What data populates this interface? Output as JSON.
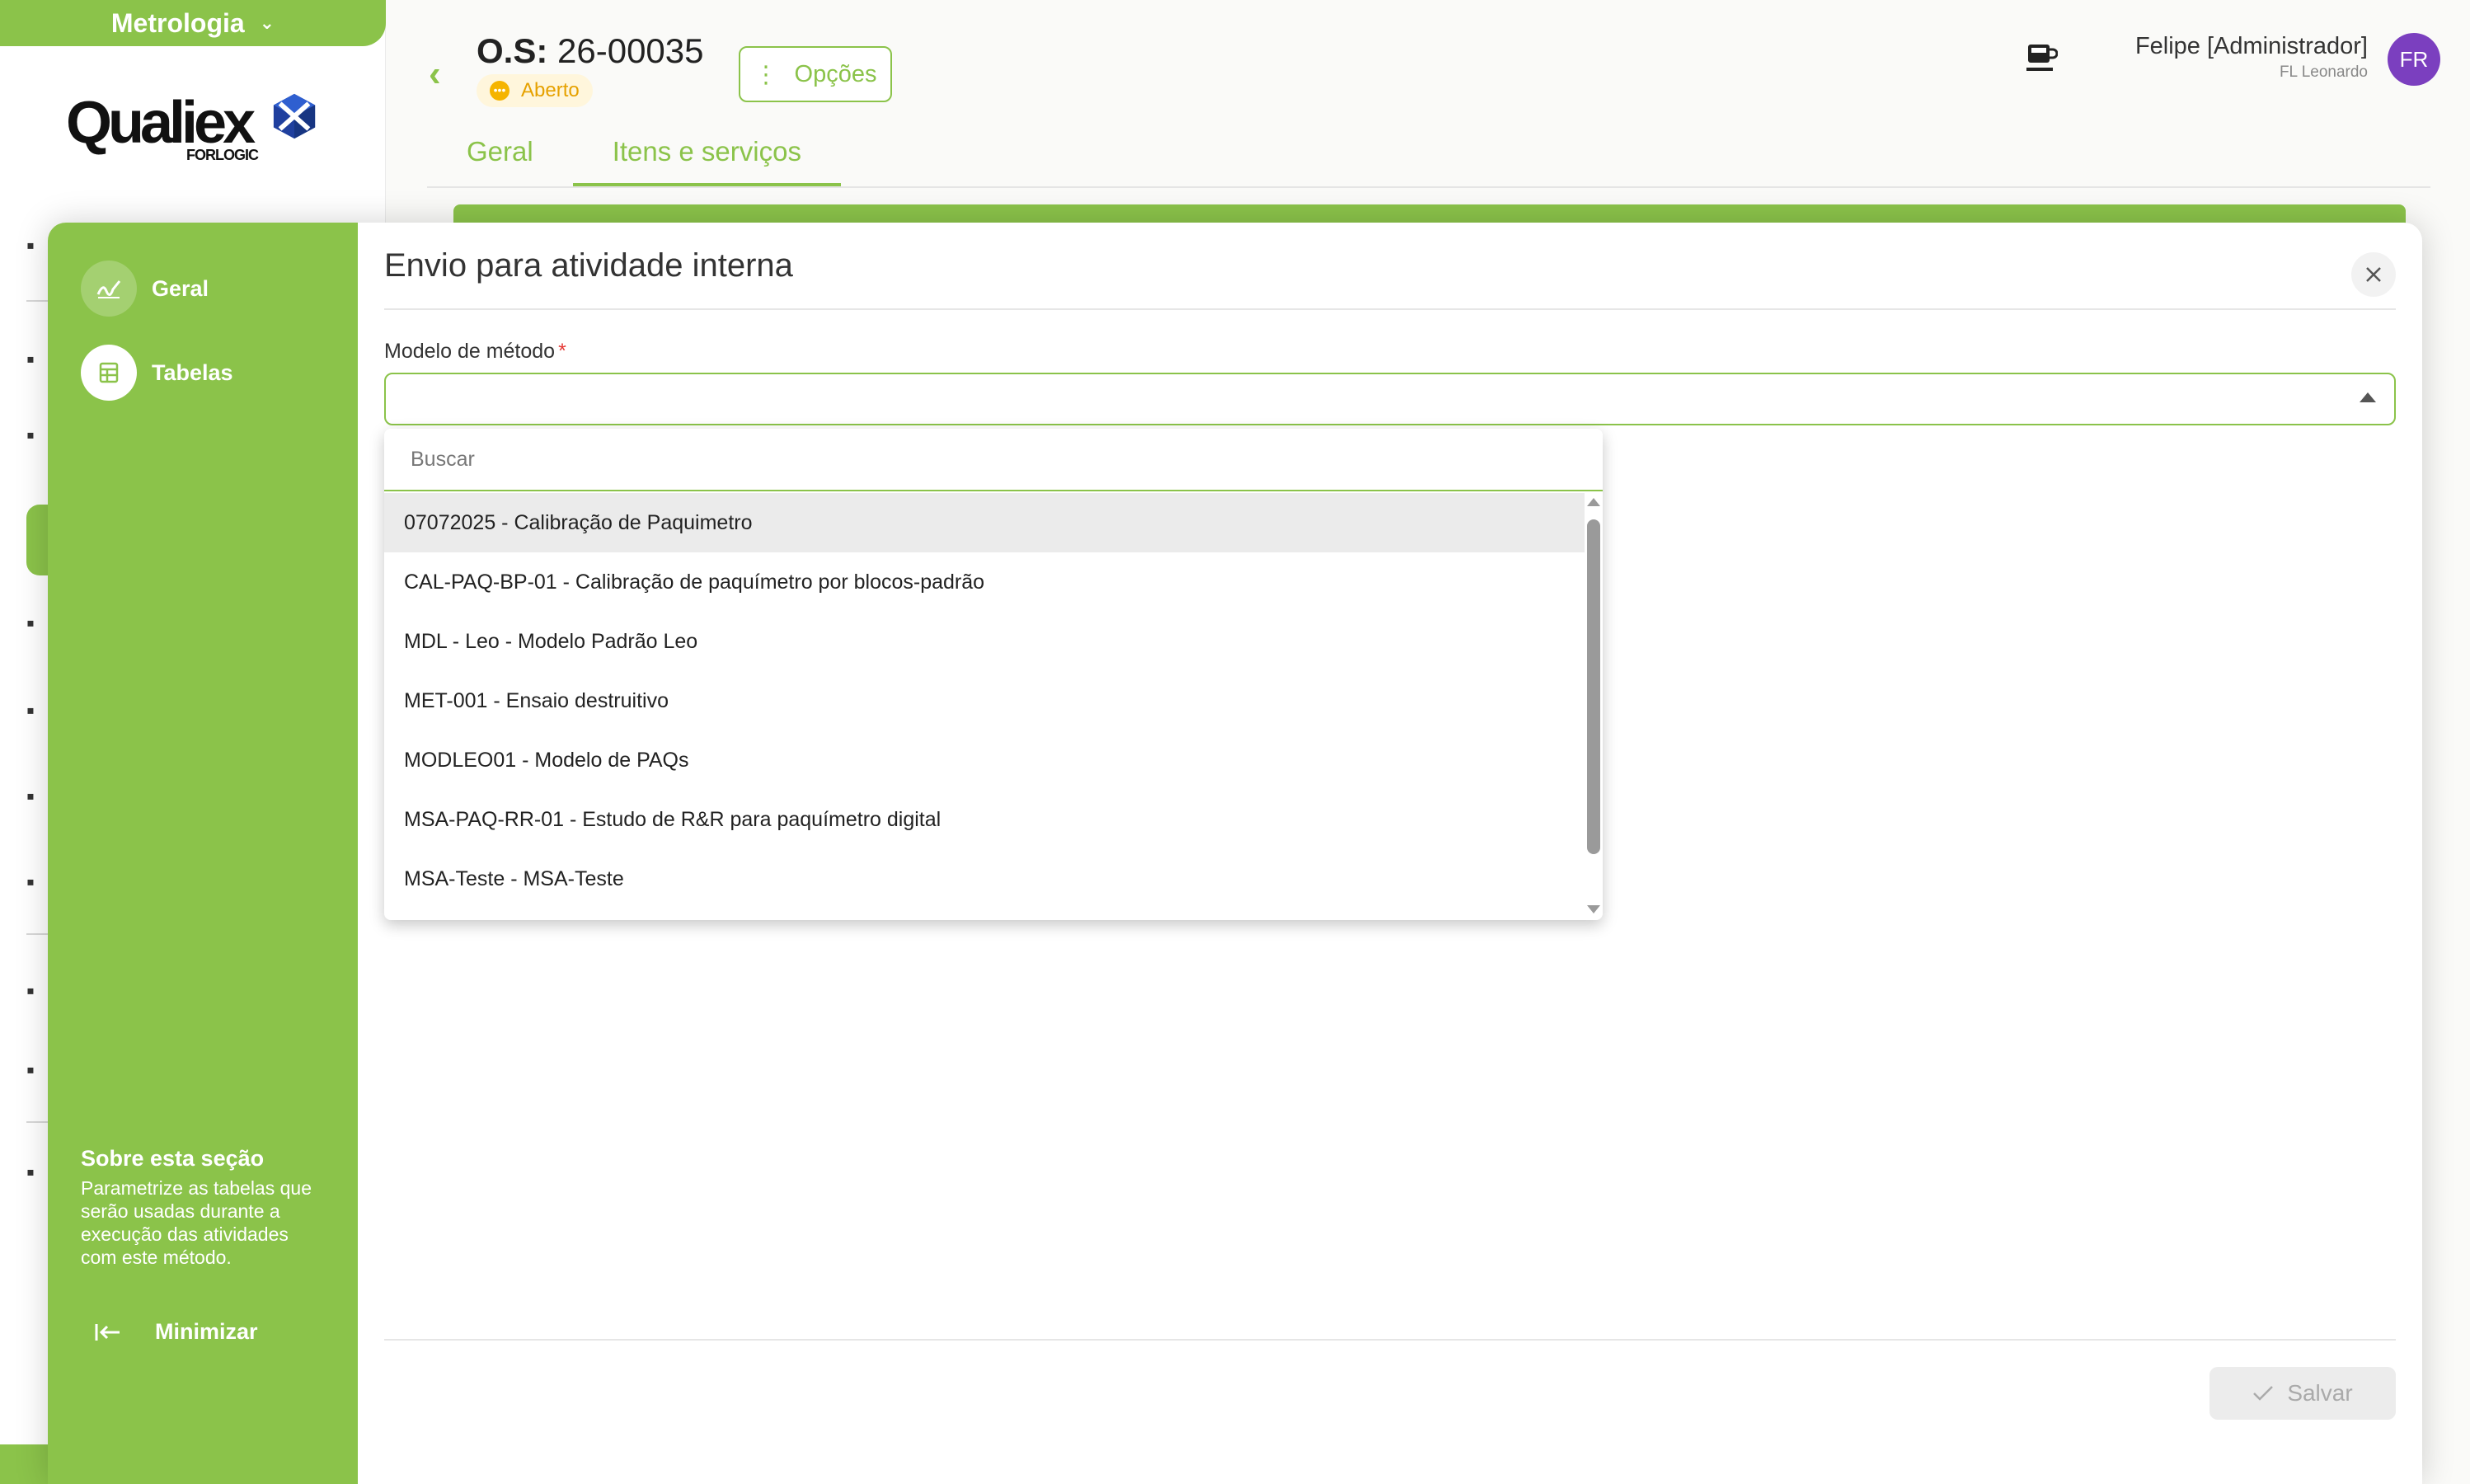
{
  "module": {
    "name": "Metrologia"
  },
  "brand": {
    "logo_text": "Qualiex",
    "logo_sub": "FORLOGIC"
  },
  "header": {
    "os_prefix": "O.S:",
    "os_number": "26-00035",
    "status": "Aberto",
    "options_label": "Opções",
    "tabs": [
      {
        "label": "Geral"
      },
      {
        "label": "Itens e serviços"
      }
    ]
  },
  "user": {
    "name": "Felipe [Administrador]",
    "company": "FL Leonardo",
    "initials": "FR"
  },
  "modal": {
    "title": "Envio para atividade interna",
    "sidebar": {
      "items": [
        {
          "label": "Geral",
          "icon": "signature-icon"
        },
        {
          "label": "Tabelas",
          "icon": "table-icon"
        }
      ],
      "about_title": "Sobre esta seção",
      "about_text": "Parametrize as tabelas que serão usadas durante a execução das atividades com este método.",
      "minimize_label": "Minimizar"
    },
    "field": {
      "label": "Modelo de método",
      "required_mark": "*",
      "value": ""
    },
    "dropdown": {
      "search_placeholder": "Buscar",
      "options": [
        "07072025 - Calibração de Paquimetro",
        "CAL-PAQ-BP-01 - Calibração de paquímetro por blocos-padrão",
        "MDL - Leo - Modelo Padrão Leo",
        "MET-001 - Ensaio destruitivo",
        "MODLEO01 - Modelo de PAQs",
        "MSA-PAQ-RR-01 - Estudo de R&R para paquímetro digital",
        "MSA-Teste - MSA-Teste"
      ],
      "highlighted_index": 0
    },
    "save_label": "Salvar"
  },
  "colors": {
    "accent": "#8bc34a",
    "avatar": "#7b3fbf",
    "status": "#f5b400"
  }
}
